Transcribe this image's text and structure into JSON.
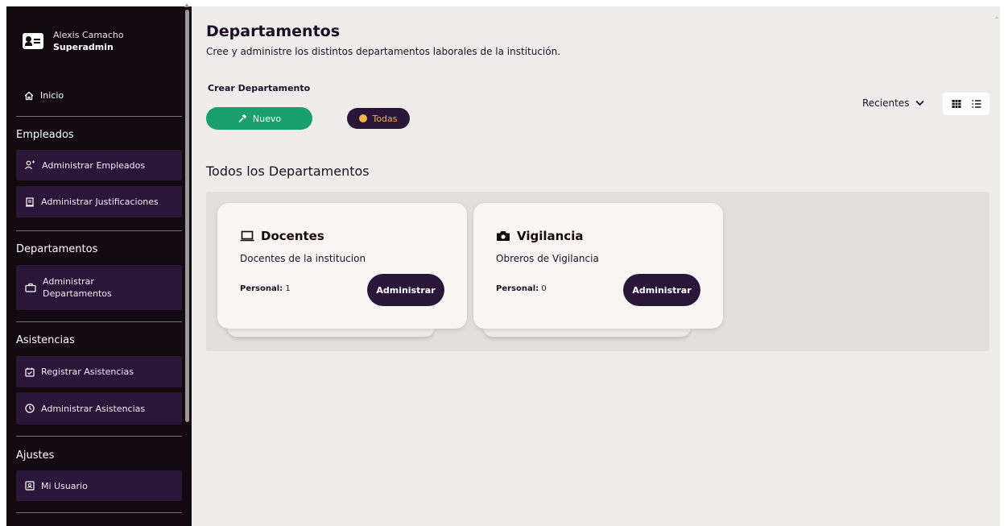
{
  "user": {
    "name": "Alexis Camacho",
    "role": "Superadmin"
  },
  "sidebar": {
    "home_label": "Inicio",
    "sections": [
      {
        "title": "Empleados",
        "items": [
          {
            "label": "Administrar Empleados",
            "icon": "users-icon"
          },
          {
            "label": "Administrar Justificaciones",
            "icon": "document-icon"
          }
        ]
      },
      {
        "title": "Departamentos",
        "items": [
          {
            "label": "Administrar Departamentos",
            "icon": "briefcase-icon"
          }
        ]
      },
      {
        "title": "Asistencias",
        "items": [
          {
            "label": "Registrar Asistencias",
            "icon": "calendar-check-icon"
          },
          {
            "label": "Administrar Asistencias",
            "icon": "clock-icon"
          }
        ]
      },
      {
        "title": "Ajustes",
        "items": [
          {
            "label": "Mi Usuario",
            "icon": "user-card-icon"
          }
        ]
      }
    ]
  },
  "main": {
    "title": "Departamentos",
    "subtitle": "Cree y administre los distintos departamentos laborales de la institución.",
    "create_label": "Crear Departamento",
    "new_button": "Nuevo",
    "filter_button": "Todas",
    "sort_label": "Recientes",
    "section_heading": "Todos los Departamentos",
    "cards": [
      {
        "name": "Docentes",
        "description": "Docentes de la institucion",
        "staff_label": "Personal:",
        "staff_count": "1",
        "button": "Administrar",
        "icon": "laptop-icon"
      },
      {
        "name": "Vigilancia",
        "description": "Obreros de Vigilancia",
        "staff_label": "Personal:",
        "staff_count": "0",
        "button": "Administrar",
        "icon": "camera-icon"
      }
    ]
  },
  "colors": {
    "sidebar_bg": "#120a0f",
    "nav_item_bg": "#2a1638",
    "accent_green": "#1aa06a",
    "accent_orange": "#f4b24a",
    "main_bg": "#efedeb"
  }
}
